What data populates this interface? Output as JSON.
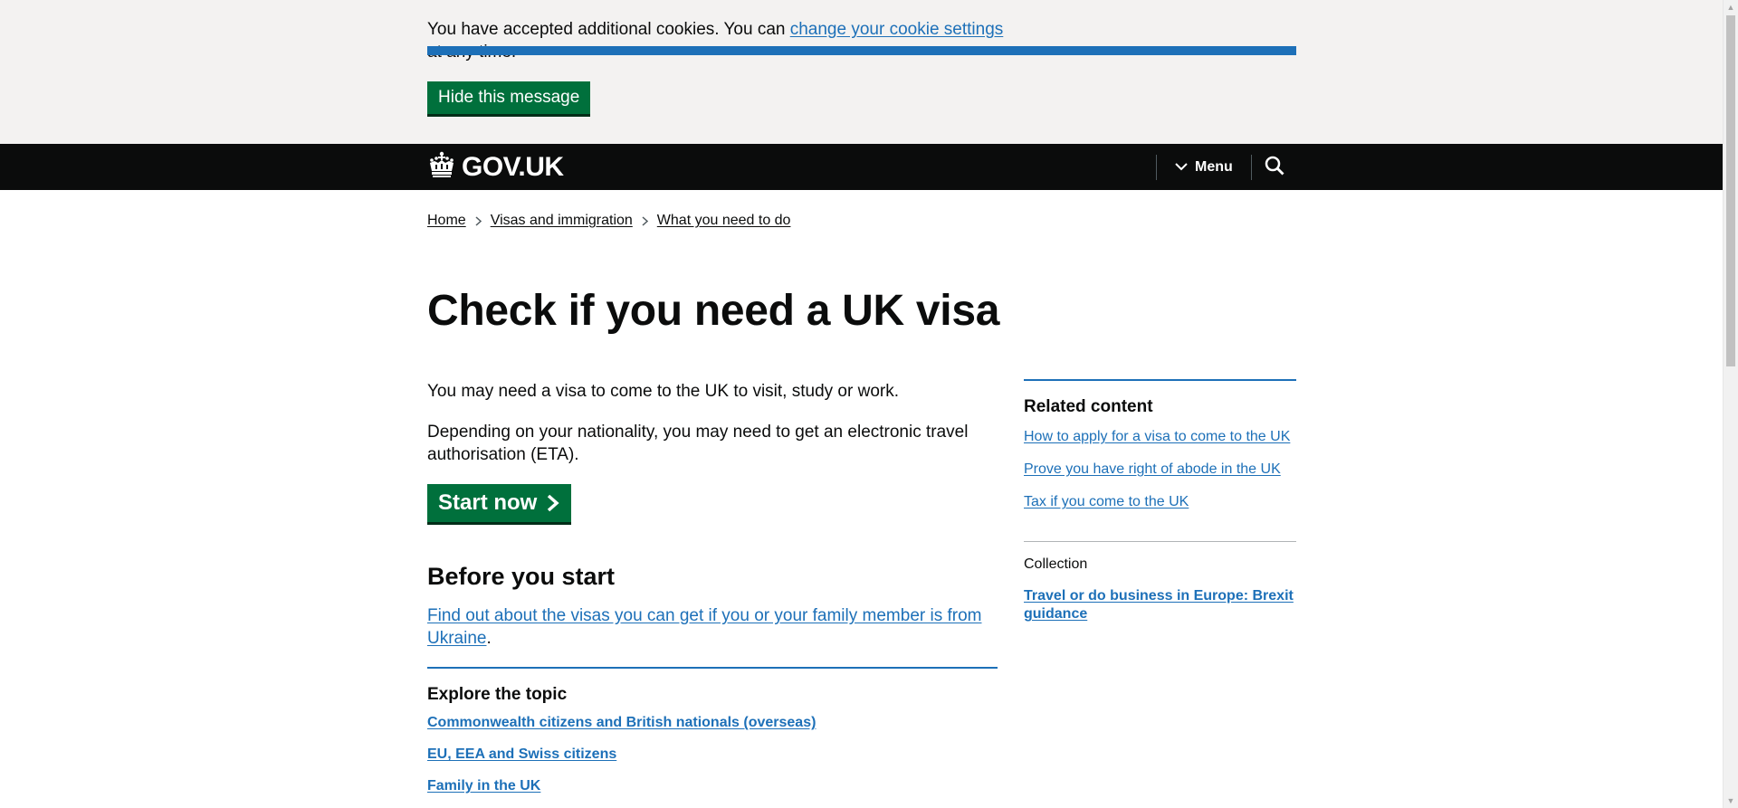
{
  "cookie_banner": {
    "text_before": "You have accepted additional cookies. You can ",
    "link": "change your cookie settings",
    "text_after": " at any time.",
    "hide_button": "Hide this message"
  },
  "header": {
    "logo_text": "GOV.UK",
    "menu_label": "Menu"
  },
  "breadcrumb": [
    "Home",
    "Visas and immigration",
    "What you need to do"
  ],
  "main": {
    "title": "Check if you need a UK visa",
    "para1": "You may need a visa to come to the UK to visit, study or work.",
    "para2": "Depending on your nationality, you may need to get an electronic travel authorisation (ETA).",
    "start_button": "Start now",
    "before_heading": "Before you start",
    "ukraine_link": "Find out about the visas you can get if you or your family member is from Ukraine",
    "ukraine_after": "."
  },
  "explore": {
    "heading": "Explore the topic",
    "links": [
      "Commonwealth citizens and British nationals (overseas)",
      "EU, EEA and Swiss citizens",
      "Family in the UK"
    ]
  },
  "related": {
    "heading": "Related content",
    "links": [
      "How to apply for a visa to come to the UK",
      "Prove you have right of abode in the UK",
      "Tax if you come to the UK"
    ]
  },
  "collection": {
    "label": "Collection",
    "link": "Travel or do business in Europe: Brexit guidance"
  },
  "colors": {
    "brand_blue": "#1d70b8",
    "button_green": "#00703c",
    "header_black": "#0b0c0c",
    "banner_grey": "#f3f2f1"
  },
  "icons": [
    "crown-icon",
    "chevron-down-icon",
    "search-icon",
    "chevron-right-icon",
    "arrow-right-icon"
  ]
}
